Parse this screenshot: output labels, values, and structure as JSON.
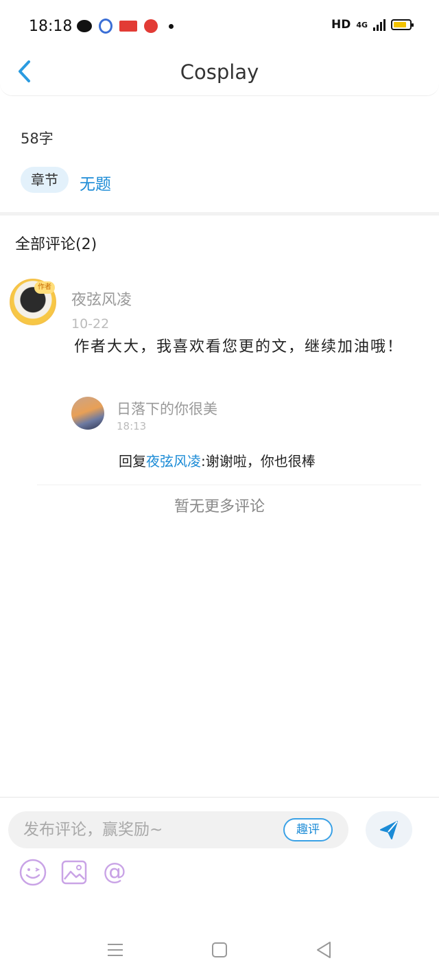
{
  "status_bar": {
    "time": "18:18",
    "network_label": "HD",
    "network_type": "4G",
    "battery_level": 0.8,
    "left_icons": [
      "wechat-icon",
      "baidu-icon",
      "toutiao-icon",
      "video-app-icon",
      "notification-dot"
    ]
  },
  "header": {
    "title": "Cosplay",
    "back_icon": "chevron-left-icon"
  },
  "chapter": {
    "word_count": "58字",
    "tag_label": "章节",
    "name": "无题"
  },
  "comments": {
    "title": "全部评论(2)",
    "items": [
      {
        "author": "夜弦风凌",
        "badge": "作者",
        "date": "10-22",
        "text": "作者大大，我喜欢看您更的文，继续加油哦！",
        "reply": {
          "author": "日落下的你很美",
          "time": "18:13",
          "prefix": "回复",
          "target": "夜弦风凌",
          "text": ":谢谢啦，你也很棒"
        }
      }
    ],
    "no_more": "暂无更多评论"
  },
  "composer": {
    "placeholder": "发布评论，赢奖励~",
    "quping_label": "趣评",
    "tools": [
      "smiley-icon",
      "image-icon",
      "at-icon"
    ],
    "send_icon": "send-icon"
  },
  "nav": {
    "buttons": [
      "menu-icon",
      "home-square-icon",
      "back-triangle-icon"
    ]
  },
  "colors": {
    "accent": "#1b8bd6",
    "tag_bg": "#e3f1fb",
    "tool_icon": "#c9a3e6",
    "badge": "#f7c745"
  }
}
